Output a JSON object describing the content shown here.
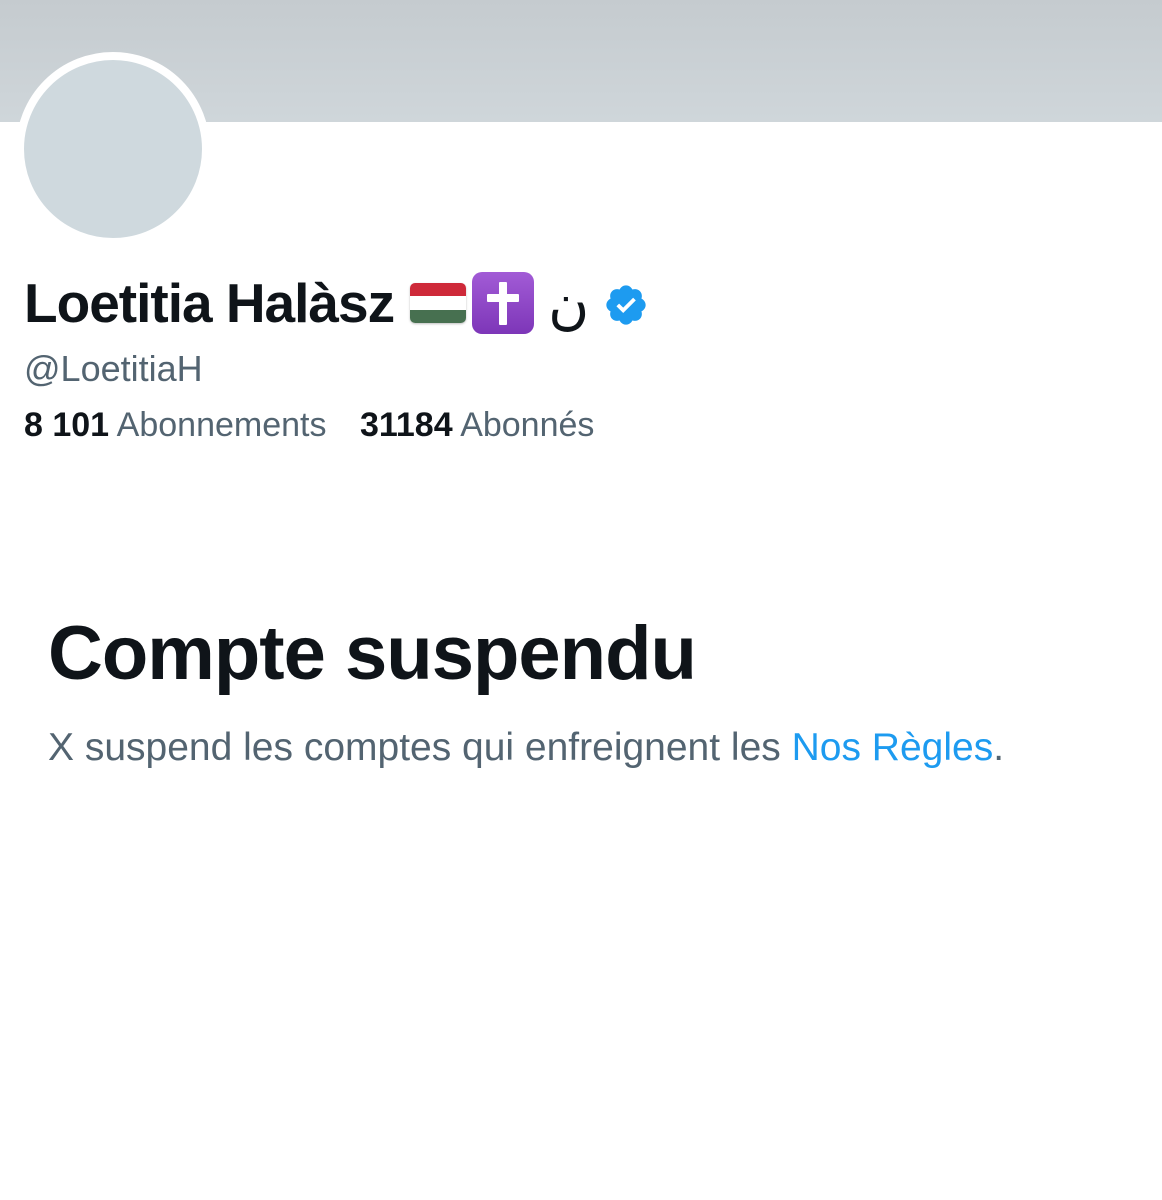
{
  "profile": {
    "display_name": "Loetitia Halàsz",
    "arabic_char": "ن",
    "handle": "@LoetitiaH",
    "emoji_icons": [
      "hungary-flag-icon",
      "latin-cross-icon",
      "verified-badge-icon"
    ]
  },
  "stats": {
    "following_count": "8 101",
    "following_label": "Abonnements",
    "followers_count": "31184",
    "followers_label": "Abonnés"
  },
  "suspension": {
    "title": "Compte suspendu",
    "message_prefix": "X suspend les comptes qui enfreignent les ",
    "link_text": "Nos Règles",
    "message_suffix": "."
  },
  "colors": {
    "primary_text": "#0f1419",
    "secondary_text": "#536471",
    "link": "#1d9bf0",
    "verified": "#1d9bf0",
    "banner": "#cfd6da",
    "avatar": "#cfd9de"
  }
}
